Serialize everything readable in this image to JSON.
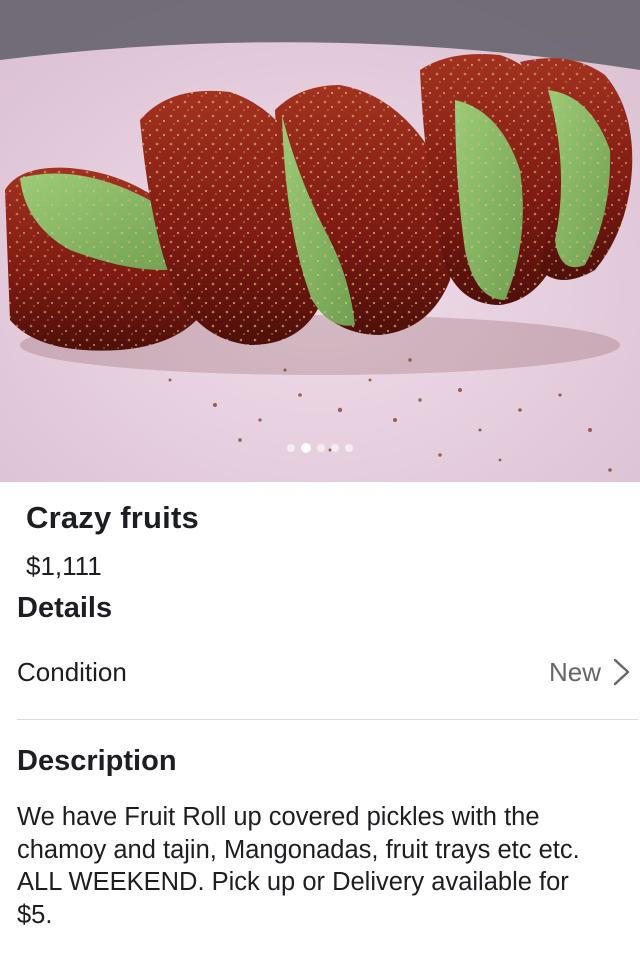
{
  "listing": {
    "photo": {
      "total": 5,
      "current": 2
    },
    "title": "Crazy fruits",
    "price": "$1,111"
  },
  "details": {
    "heading": "Details",
    "condition_label": "Condition",
    "condition_value": "New",
    "chevron_icon": "chevron-right-icon"
  },
  "description": {
    "heading": "Description",
    "text": "We have Fruit Roll up covered pickles with the\nchamoy and tajin, Mangonadas, fruit trays etc etc.\nALL WEEKEND. Pick up or  Delivery available for\n$5."
  },
  "colors": {
    "plate": "#e9d2e3",
    "coating": "#8a1f14",
    "pickle": "#8fbf6a",
    "divider": "#dadde1"
  }
}
